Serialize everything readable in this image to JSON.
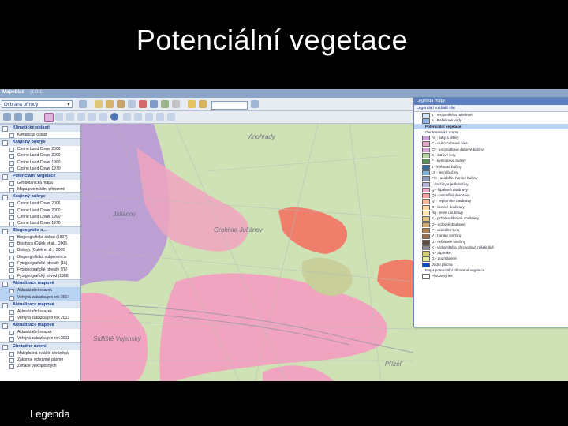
{
  "slide": {
    "title": "Potenciální  vegetace",
    "footer": "Legenda"
  },
  "app": {
    "name": "Mapoblad",
    "version": "(1.0.1)"
  },
  "toolbar": {
    "combo_value": "Ochrana přírody"
  },
  "sidebar": {
    "groups": [
      {
        "label": "Klimatické oblasti",
        "items": [
          "Klimatické oblast"
        ]
      },
      {
        "label": "Krajinný pokryv",
        "items": [
          "Corine Land Cover 2006",
          "Corine Land Cover 2000",
          "Corine Land Cover 1990",
          "Corine Land Cover 1970"
        ]
      },
      {
        "label": "Potenciální vegetace",
        "items": [
          "Geobotanická mapa",
          "Mapa potenciální přirozené"
        ]
      },
      {
        "label": "Krajinný pokryv",
        "items": [
          "Corine Land Cover 2006",
          "Corine Land Cover 2000",
          "Corine Land Cover 1990",
          "Corine Land Cover 1970"
        ]
      },
      {
        "label": "Biogeografie o...",
        "items": [
          "Biogeografická oblast (1997)",
          "Bioshora (Culek et al... 2005",
          "Biotopy (Culek et al... 2005",
          "Biogeografická subprovincie",
          "Fytogeografické obvody (16)",
          "Fytogeografické obvody (76)",
          "Fytogeografický obvod (1988)"
        ]
      },
      {
        "label": "Aktualizace mapové",
        "items": [
          "Aktualizační svazek",
          "Veřejná zakázka pro rok 2014"
        ],
        "selected": [
          0,
          1
        ]
      },
      {
        "label": "Aktualizace mapové",
        "items": [
          "Aktualizační svazek",
          "Veřejná zakázka pro rok 2013"
        ]
      },
      {
        "label": "Aktualizace mapové",
        "items": [
          "Aktualizační svazek",
          "Veřejná zakázka pro rok 2011"
        ]
      },
      {
        "label": "Chráněné území",
        "items": [
          "Maloplošná zvláště chráněná",
          "Zákonné ochranné pásmo",
          "Zonace velkoplošných"
        ]
      }
    ]
  },
  "legend": {
    "title": "Legenda mapy",
    "tab": "Legenda / rozbalit vše",
    "rows": [
      {
        "label": "4 - Vrchoviště a rašelinné",
        "color": "#d8e4f6"
      },
      {
        "label": "5 - Rašelinné vody",
        "color": "#8fb1e6"
      },
      {
        "label": "Potenciální vegetace",
        "header": true,
        "selected": true
      },
      {
        "label": "Geobotanická mapa",
        "header": true
      },
      {
        "label": "Ac - luhy a olšiny",
        "color": "#c7a2d6"
      },
      {
        "label": "C - dubo-habrové háje",
        "color": "#e6a9c6"
      },
      {
        "label": "CF - pcomalbové dubové bučiny",
        "color": "#d3a2cf"
      },
      {
        "label": "S - suťové lesy",
        "color": "#b9d6a2"
      },
      {
        "label": "F - květnatové bučiny",
        "color": "#5e8f5a"
      },
      {
        "label": "J - květnatá bučiny",
        "color": "#3a6a9a"
      },
      {
        "label": "LF - lesní bučiny",
        "color": "#7ab4d8"
      },
      {
        "label": "Fm - acidofilní horské bučiny",
        "color": "#8a9ab8"
      },
      {
        "label": "I - bučiny a jedlobučiny",
        "color": "#b9b3da"
      },
      {
        "label": "Q - šipákové doubravy",
        "color": "#f3a7c8"
      },
      {
        "label": "Qa - acidofilní doubravy",
        "color": "#f6a0a0"
      },
      {
        "label": "Qt - teplomilné doubravy",
        "color": "#fbb89a"
      },
      {
        "label": "D - borové doubravy",
        "color": "#ffd5a2"
      },
      {
        "label": "Rq - teplé doubravy",
        "color": "#ffe7b0"
      },
      {
        "label": "E - pcholeodiferové doubravy",
        "color": "#e0c27c"
      },
      {
        "label": "O - pclkové doubravy",
        "color": "#d4a873"
      },
      {
        "label": "P - acidofilní bory",
        "color": "#b48150"
      },
      {
        "label": "V - horské smrčiny",
        "color": "#9a6f4b"
      },
      {
        "label": "U - rašelinné smrčiny",
        "color": "#5f4c42"
      },
      {
        "label": "K - vrchoviště a přechodová rašeliniště",
        "color": "#8c8c8c"
      },
      {
        "label": "N - alpínské",
        "color": "#d6d06a"
      },
      {
        "label": "G - podmáčené",
        "color": "#e4ec9a"
      },
      {
        "label": "Vodní plocha",
        "color": "#1546c8"
      },
      {
        "label": "Mapa potenciální přirozené vegetace",
        "header": true
      },
      {
        "label": "Přirozený les",
        "color": "#ffffff"
      }
    ]
  },
  "map": {
    "labels": [
      "Vinohrady",
      "Juliánov",
      "Grohlsta Juliánov",
      "Sídliště Vojenský",
      "Přízeř"
    ]
  },
  "colors": {
    "background": "#000000",
    "title_text": "#ffffff",
    "map_green": "#cfe2b5",
    "pink": "#f1a4bf",
    "purple": "#b998d6",
    "red": "#f27362",
    "olive": "#c8cf9a",
    "accent_blue": "#5b7fc0"
  }
}
